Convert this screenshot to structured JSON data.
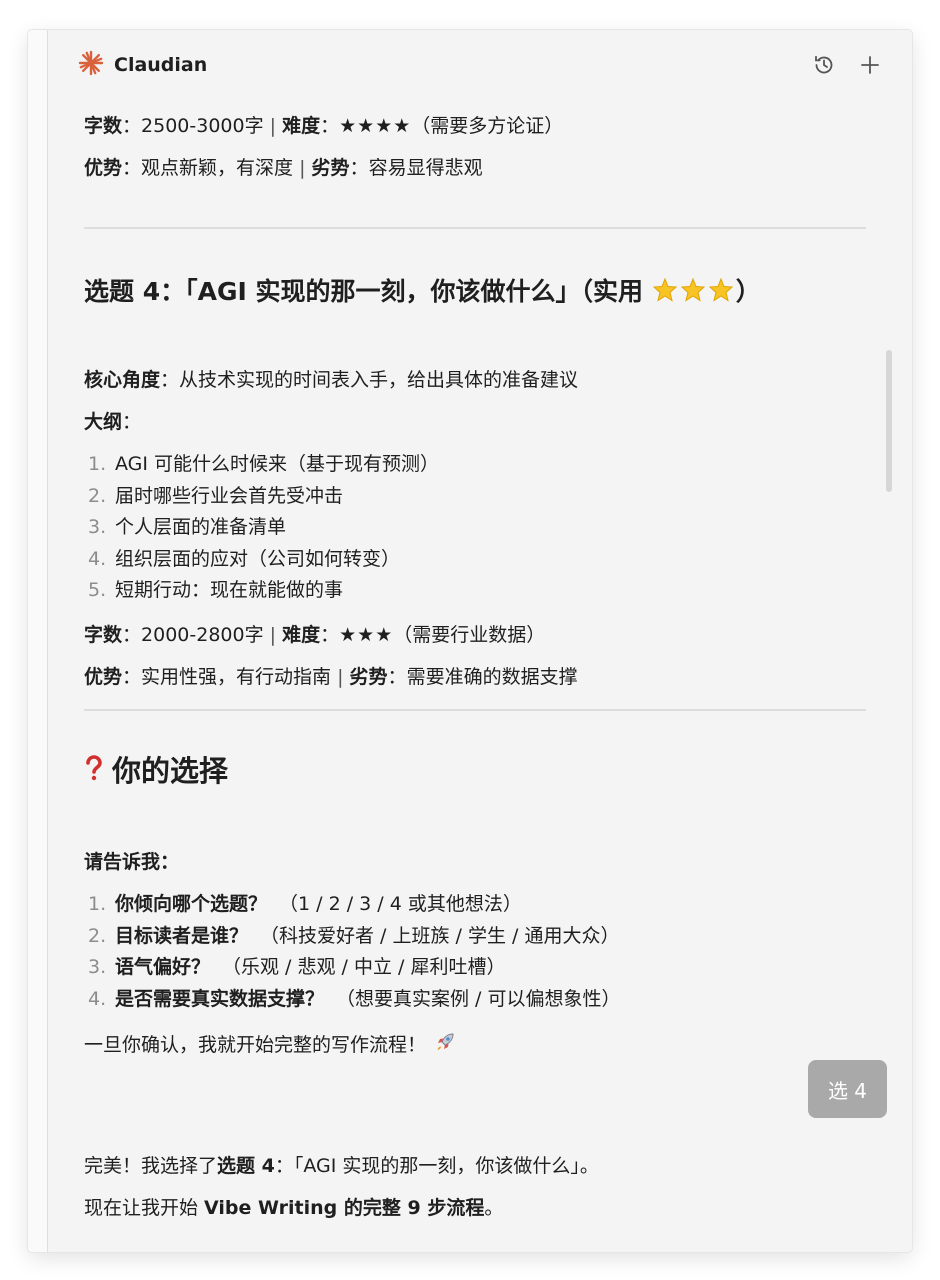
{
  "app": {
    "title": "Claudian",
    "accent": "#d9623c"
  },
  "header": {
    "history_icon": "history-icon",
    "new_icon": "plus-icon"
  },
  "topic3_tail": {
    "wordcount_label": "字数",
    "wordcount_value": "2500-3000字",
    "difficulty_label": "难度",
    "difficulty_stars": "★★★★",
    "difficulty_note": "（需要多方论证）",
    "pros_label": "优势",
    "pros_value": "观点新颖，有深度",
    "cons_label": "劣势",
    "cons_value": "容易显得悲观"
  },
  "topic4": {
    "heading": "选题 4：「AGI 实现的那一刻，你该做什么」（实用 ",
    "heading_end": "）",
    "core_label": "核心角度",
    "core_value": "从技术实现的时间表入手，给出具体的准备建议",
    "outline_label": "大纲",
    "outline": [
      {
        "num": "1.",
        "text": "AGI 可能什么时候来（基于现有预测）"
      },
      {
        "num": "2.",
        "text": "届时哪些行业会首先受冲击"
      },
      {
        "num": "3.",
        "text": "个人层面的准备清单"
      },
      {
        "num": "4.",
        "text": "组织层面的应对（公司如何转变）"
      },
      {
        "num": "5.",
        "text": "短期行动：现在就能做的事"
      }
    ],
    "wordcount_label": "字数",
    "wordcount_value": "2000-2800字",
    "difficulty_label": "难度",
    "difficulty_stars": "★★★",
    "difficulty_note": "（需要行业数据）",
    "pros_label": "优势",
    "pros_value": "实用性强，有行动指南",
    "cons_label": "劣势",
    "cons_value": "需要准确的数据支撑"
  },
  "choice": {
    "heading": "你的选择",
    "prompt": "请告诉我：",
    "questions": [
      {
        "num": "1.",
        "q": "你倾向哪个选题？",
        "opts": "（1 / 2 / 3 / 4 或其他想法）"
      },
      {
        "num": "2.",
        "q": "目标读者是谁？",
        "opts": "（科技爱好者 / 上班族 / 学生 / 通用大众）"
      },
      {
        "num": "3.",
        "q": "语气偏好？",
        "opts": "（乐观 / 悲观 / 中立 / 犀利吐槽）"
      },
      {
        "num": "4.",
        "q": "是否需要真实数据支撑？",
        "opts": "（想要真实案例 / 可以偏想象性）"
      }
    ],
    "closing": "一旦你确认，我就开始完整的写作流程！"
  },
  "user_message": "选 4",
  "reply": {
    "line1_pre": "完美！我选择了",
    "line1_bold": "选题 4",
    "line1_post": "：「AGI 实现的那一刻，你该做什么」。",
    "line2_pre": "现在让我开始 ",
    "line2_bold": "Vibe Writing 的完整 9 步流程",
    "line2_post": "。"
  }
}
